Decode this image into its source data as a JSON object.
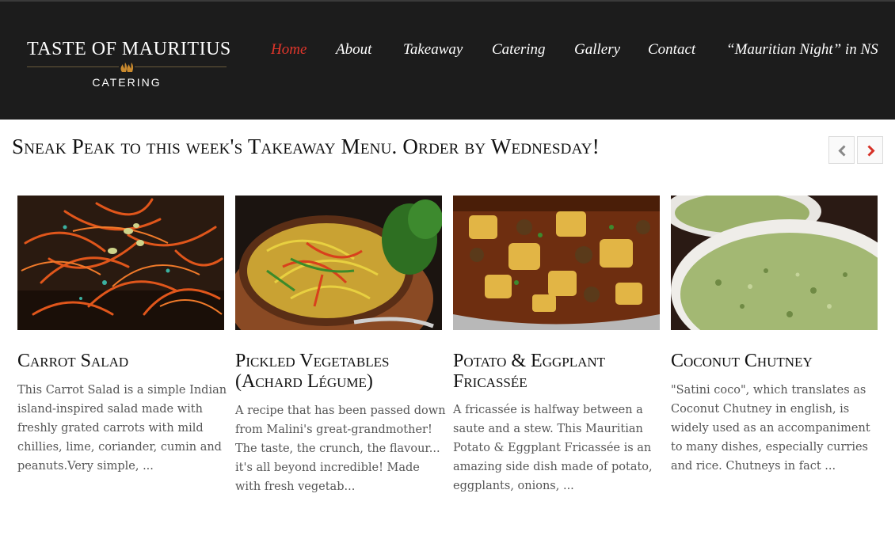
{
  "logo": {
    "title": "TASTE OF MAURITIUS",
    "subtitle": "CATERING"
  },
  "nav": {
    "items": [
      {
        "label": "Home"
      },
      {
        "label": "About"
      },
      {
        "label": "Takeaway"
      },
      {
        "label": "Catering"
      },
      {
        "label": "Gallery"
      },
      {
        "label": "Contact"
      },
      {
        "label": "“Mauritian Night” in NS"
      }
    ],
    "active": "Home"
  },
  "section": {
    "title": "Sneak Peak to this week's Takeaway Menu. Order by Wednesday!"
  },
  "carousel": {
    "prev_icon": "chevron-left-icon",
    "next_icon": "chevron-right-icon"
  },
  "cards": [
    {
      "title": "Carrot Salad",
      "description": "This Carrot Salad is a simple Indian island-inspired salad made with freshly grated carrots with mild chillies, lime, coriander, cumin and peanuts.Very simple, ..."
    },
    {
      "title": "Pickled Vegetables (Achard Légume)",
      "description": "A recipe that has been passed down from Malini's great-grandmother! The taste, the crunch, the flavour... it's all beyond incredible! Made with fresh vegetab..."
    },
    {
      "title": "Potato & Eggplant Fricassée",
      "description": "A fricassée is halfway between a saute and a stew. This Mauritian Potato & Eggplant Fricassée is an amazing side dish made of potato, eggplants, onions, ..."
    },
    {
      "title": "Coconut Chutney",
      "description": "\"Satini coco\", which translates as Coconut Chutney in english, is widely used as an accompaniment to many dishes, especially curries and rice. Chutneys in fact ..."
    }
  ],
  "colors": {
    "header_bg": "#1c1c1c",
    "accent": "#e2362b",
    "text": "#555555"
  }
}
